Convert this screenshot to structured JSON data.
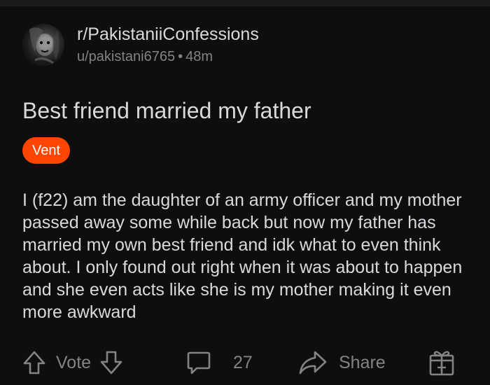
{
  "post": {
    "subreddit": "r/PakistaniiConfessions",
    "author": "u/pakistani6765",
    "separator": "•",
    "age": "48m",
    "title": "Best friend married my father",
    "flair": "Vent",
    "body": "I (f22) am the daughter of an army officer and my mother passed away some while back but now my father has married my own best friend and idk what to even think about. I only found out right when it was about to happen and she even acts like she is my mother making it even more awkward"
  },
  "actions": {
    "vote_label": "Vote",
    "comment_count": "27",
    "share_label": "Share"
  },
  "icons": {
    "upvote": "upvote-arrow-icon",
    "downvote": "downvote-arrow-icon",
    "comment": "comment-bubble-icon",
    "share": "share-arrow-icon",
    "award": "gift-award-icon"
  },
  "colors": {
    "background": "#0e0e0f",
    "text_primary": "#d7dadc",
    "text_secondary": "#818384",
    "flair_bg": "#ff4500"
  }
}
